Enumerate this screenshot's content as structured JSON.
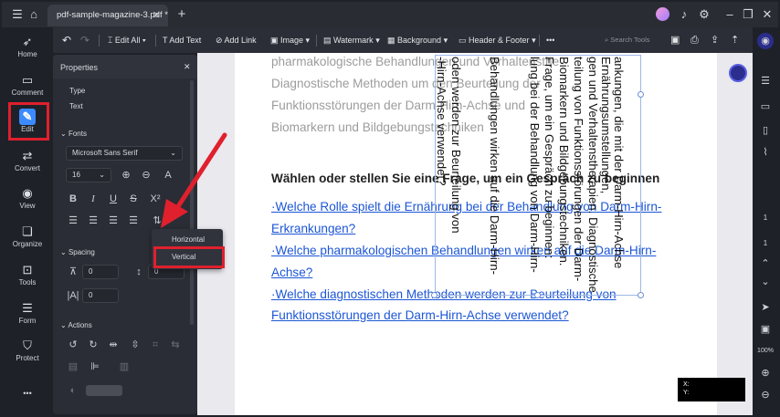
{
  "title_bar": {
    "tab_label": "pdf-sample-magazine-3.pdf *",
    "tab_close": "✕",
    "new_tab": "+",
    "window_controls": [
      "–",
      "❐",
      "✕"
    ]
  },
  "left_nav": {
    "items": [
      {
        "label": "Home",
        "icon": "rocket-icon",
        "glyph": "➶"
      },
      {
        "label": "Comment",
        "icon": "comment-icon",
        "glyph": "▭"
      },
      {
        "label": "Edit",
        "icon": "edit-icon",
        "glyph": "✎"
      },
      {
        "label": "Convert",
        "icon": "convert-icon",
        "glyph": "⇄"
      },
      {
        "label": "View",
        "icon": "eye-icon",
        "glyph": "◉"
      },
      {
        "label": "Organize",
        "icon": "organize-icon",
        "glyph": "❏"
      },
      {
        "label": "Tools",
        "icon": "toolbox-icon",
        "glyph": "⊡"
      },
      {
        "label": "Form",
        "icon": "form-icon",
        "glyph": "☰"
      },
      {
        "label": "Protect",
        "icon": "shield-icon",
        "glyph": "⛉"
      }
    ],
    "more": "•••"
  },
  "toolbar": {
    "edit_all": "Edit All",
    "add_text": "Add Text",
    "add_link": "Add Link",
    "image": "Image",
    "watermark": "Watermark",
    "background": "Background",
    "header_footer": "Header & Footer",
    "more": "•••",
    "search_placeholder": "Search Tools"
  },
  "properties": {
    "title": "Properties",
    "close": "✕",
    "type_label": "Type",
    "type_value": "Text",
    "fonts_label": "Fonts",
    "font_family": "Microsoft Sans Serif",
    "font_size": "16",
    "spacing_label": "Spacing",
    "spacing_a": "0",
    "spacing_b": "0",
    "spacing_c": "0",
    "actions_label": "Actions"
  },
  "direction_menu": {
    "options": [
      "Horizontal",
      "Vertical"
    ],
    "selected": "Vertical"
  },
  "document": {
    "grey_lines": [
      "pharmakologische Behandlungen und Verhaltensthe",
      "Diagnostische Methoden um den Beurteilung der",
      "Funktionsstörungen der Darm-Hirn-Achse und",
      "Biomarkern und Bildgebungstechniken"
    ],
    "heading": "Wählen oder stellen Sie eine Frage, um ein Gespräch zu beginnen",
    "links": [
      "·Welche Rolle spielt die Ernährung bei der Behandlung von Darm-Hirn-",
      "Erkrankungen?",
      "·Welche pharmakologischen Behandlungen wirken auf die Darm-Hirn-",
      "Achse?",
      "·Welche diagnostischen Methoden werden zur Beurteilung von",
      "Funktionsstörungen der Darm-Hirn-Achse verwendet?"
    ],
    "vertical_columns": [
      "ankungen, die mit der Darm-Hirn-Achse",
      "Ernährungsumstellungen,",
      "gen und Verhaltenstherapien. Diagnostische",
      "teilung von Funktionsstörungen der Darm-",
      "Biomarkern und Bildgebungstechniken.",
      "Frage, um ein Gespräch zu beginnen:",
      "lung bei der Behandlung von Darm-Hirn-",
      "Behandlungen wirken auf die Darm-Hirn-",
      "oden werden zur Beurteilung von",
      "-Hirn-Achse verwendet?"
    ]
  },
  "right_bar": {
    "page_current": "1",
    "page_total": "1",
    "zoom": "100%"
  },
  "coords": {
    "x_label": "X:",
    "y_label": "Y:"
  },
  "colors": {
    "accent": "#3c8aff",
    "highlight_box": "#e0202d",
    "link": "#1c56d6",
    "arrow": "#e0202d"
  }
}
